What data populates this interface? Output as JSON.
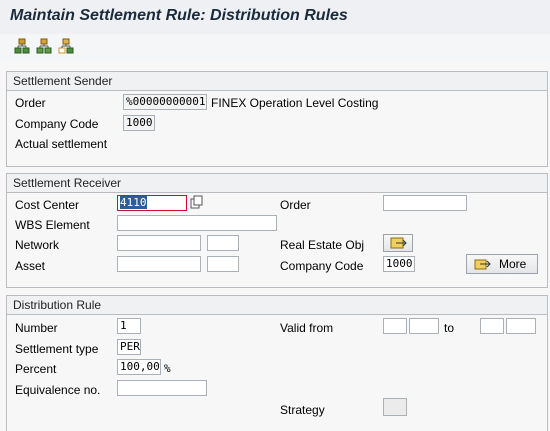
{
  "window": {
    "title": "Maintain Settlement Rule: Distribution Rules"
  },
  "toolbar": {
    "icons": [
      "hierarchy-icon",
      "tree-structure-icon",
      "org-chart-icon"
    ]
  },
  "sender": {
    "header": "Settlement Sender",
    "order_label": "Order",
    "order_value": "%00000000001",
    "order_desc": "FINEX Operation Level Costing",
    "company_code_label": "Company Code",
    "company_code_value": "1000",
    "actual_settlement": "Actual settlement"
  },
  "receiver": {
    "header": "Settlement Receiver",
    "cost_center_label": "Cost Center",
    "cost_center_value": "4110",
    "wbs_label": "WBS Element",
    "network_label": "Network",
    "asset_label": "Asset",
    "order_label": "Order",
    "real_estate_label": "Real Estate Obj",
    "company_code_label": "Company Code",
    "company_code_value": "1000",
    "more_label": "More"
  },
  "rule": {
    "header": "Distribution Rule",
    "number_label": "Number",
    "number_value": "1",
    "settlement_type_label": "Settlement type",
    "settlement_type_value": "PER",
    "percent_label": "Percent",
    "percent_value": "100,00",
    "percent_unit": "%",
    "equivalence_label": "Equivalence no.",
    "valid_from_label": "Valid from",
    "to_label": "to",
    "strategy_label": "Strategy"
  },
  "colors": {
    "accent": "#2c5e9b",
    "focus_border": "#c8102e",
    "title": "#1b2b3c"
  }
}
